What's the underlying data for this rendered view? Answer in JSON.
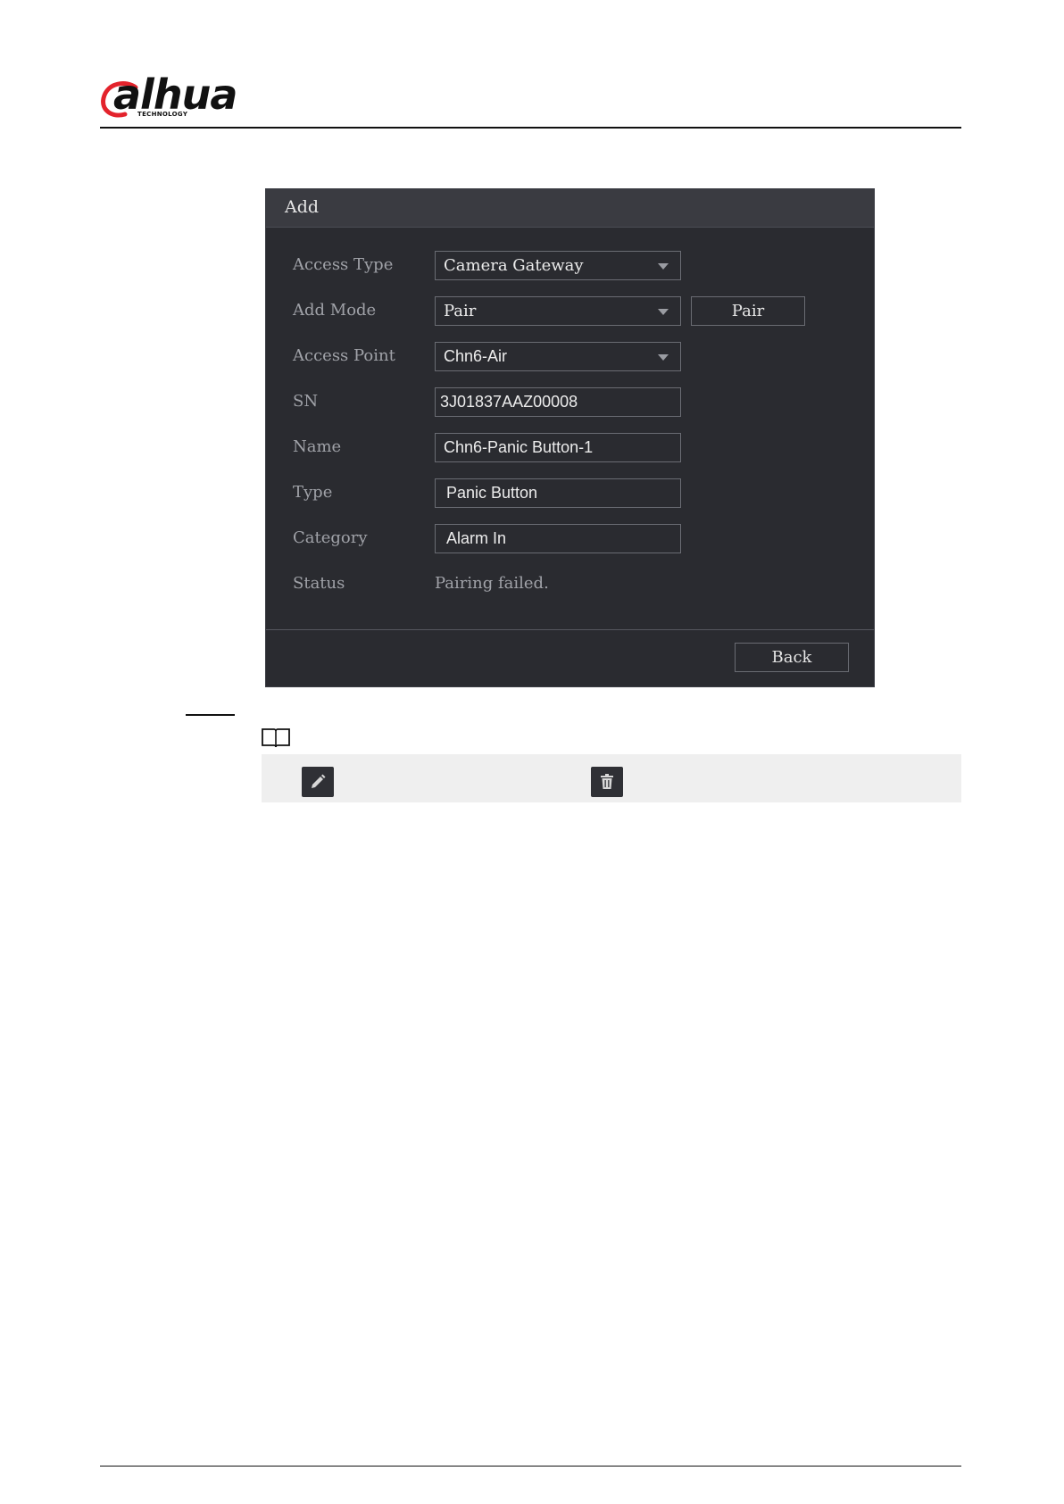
{
  "header": {
    "logo_text": "alhua",
    "logo_sub": "TECHNOLOGY"
  },
  "dialog": {
    "title": "Add",
    "fields": {
      "access_type": {
        "label": "Access Type",
        "value": "Camera Gateway"
      },
      "add_mode": {
        "label": "Add Mode",
        "value": "Pair",
        "button": "Pair"
      },
      "access_point": {
        "label": "Access Point",
        "value": "Chn6-Air"
      },
      "sn": {
        "label": "SN",
        "value": "3J01837AAZ00008"
      },
      "name": {
        "label": "Name",
        "value": "Chn6-Panic Button-1"
      },
      "type": {
        "label": "Type",
        "value": "Panic Button"
      },
      "category": {
        "label": "Category",
        "value": "Alarm In"
      },
      "status": {
        "label": "Status",
        "value": "Pairing failed."
      }
    },
    "back_label": "Back"
  },
  "icons": [
    "book-icon",
    "pencil-icon",
    "trash-icon"
  ],
  "colors": {
    "dialog_bg": "#2a2b30",
    "title_bg": "#3a3b41",
    "logo_red": "#e3232c",
    "note_bg": "#efefef"
  }
}
